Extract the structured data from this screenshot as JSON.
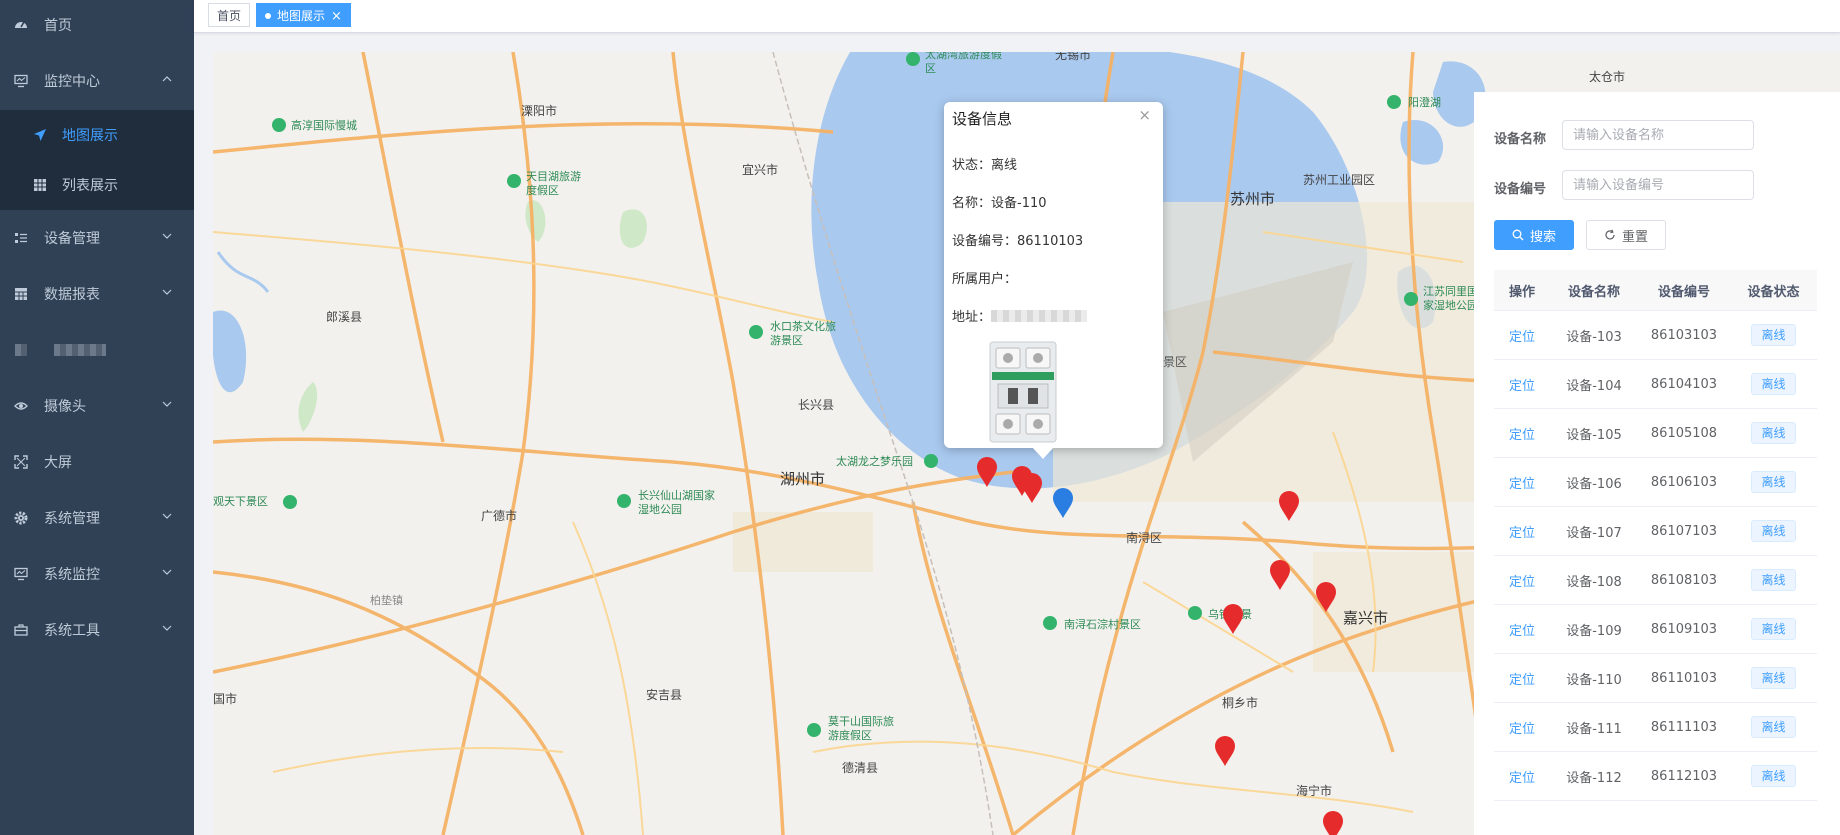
{
  "sidebar": {
    "items": [
      {
        "label": "首页",
        "icon": "dashboard-icon"
      },
      {
        "label": "监控中心",
        "icon": "monitor-icon",
        "expanded": true,
        "children": [
          {
            "label": "地图展示",
            "icon": "send-icon",
            "active": true
          },
          {
            "label": "列表展示",
            "icon": "grid-icon"
          }
        ]
      },
      {
        "label": "设备管理",
        "icon": "list-icon"
      },
      {
        "label": "数据报表",
        "icon": "table-icon"
      },
      {
        "label": "",
        "icon": "blurred-icon"
      },
      {
        "label": "摄像头",
        "icon": "eye-icon"
      },
      {
        "label": "大屏",
        "icon": "fullscreen-icon"
      },
      {
        "label": "系统管理",
        "icon": "gear-icon"
      },
      {
        "label": "系统监控",
        "icon": "monitor-icon"
      },
      {
        "label": "系统工具",
        "icon": "toolbox-icon"
      }
    ]
  },
  "tags": {
    "home": "首页",
    "current": "地图展示"
  },
  "map": {
    "labels": {
      "huzhou": "湖州市",
      "suzhou": "苏州市",
      "jiaxing": "嘉兴市",
      "changxing": "长兴县",
      "guangde": "广德市",
      "anji": "安吉县",
      "deqing": "德清县",
      "nanxun": "南浔区",
      "tongxiang": "桐乡市",
      "haining": "海宁市",
      "langxi": "郎溪县",
      "liyang": "溧阳市",
      "yixing": "宜兴市",
      "suzhou_ind": "苏州工业园区",
      "taicang": "太仓市",
      "wuxi": "无锡市",
      "baiyan": "柏垫镇",
      "ji_shi": "国市",
      "gaochun": "高淳国际慢城",
      "tianmuhu": "天目湖旅游度假区",
      "shuikou": "水口茶文化旅游景区",
      "taihulong": "太湖龙之梦乐园",
      "changxing_wetland": "长兴仙山湖国家湿地公园",
      "tianxia": "观天下景区",
      "mogan": "莫干山国际旅游度假区",
      "nanxun_scenic": "南浔石淙村景区",
      "wuzhen": "乌镇风景",
      "yangcheng": "阳澄湖",
      "jiangsu_wetland": "江苏同里国家湿地公园",
      "taihu_resort": "太湖湾旅游度假区",
      "jing_qu": "景区"
    }
  },
  "popup": {
    "title": "设备信息",
    "close": "×",
    "status_label": "状态：",
    "status": "离线",
    "name_label": "名称：",
    "name": "设备-110",
    "code_label": "设备编号：",
    "code": "86110103",
    "owner_label": "所属用户：",
    "owner": "",
    "address_label": "地址：",
    "address": ""
  },
  "search": {
    "name_label": "设备名称",
    "name_placeholder": "请输入设备名称",
    "code_label": "设备编号",
    "code_placeholder": "请输入设备编号",
    "search_btn": "搜索",
    "reset_btn": "重置"
  },
  "table": {
    "headers": [
      "操作",
      "设备名称",
      "设备编号",
      "设备状态"
    ],
    "rows": [
      {
        "action": "定位",
        "name": "设备-103",
        "code": "86103103",
        "status": "离线"
      },
      {
        "action": "定位",
        "name": "设备-104",
        "code": "86104103",
        "status": "离线"
      },
      {
        "action": "定位",
        "name": "设备-105",
        "code": "86105108",
        "status": "离线"
      },
      {
        "action": "定位",
        "name": "设备-106",
        "code": "86106103",
        "status": "离线"
      },
      {
        "action": "定位",
        "name": "设备-107",
        "code": "86107103",
        "status": "离线"
      },
      {
        "action": "定位",
        "name": "设备-108",
        "code": "86108103",
        "status": "离线"
      },
      {
        "action": "定位",
        "name": "设备-109",
        "code": "86109103",
        "status": "离线"
      },
      {
        "action": "定位",
        "name": "设备-110",
        "code": "86110103",
        "status": "离线"
      },
      {
        "action": "定位",
        "name": "设备-111",
        "code": "86111103",
        "status": "离线"
      },
      {
        "action": "定位",
        "name": "设备-112",
        "code": "86112103",
        "status": "离线"
      }
    ]
  },
  "colors": {
    "sidebar_bg": "#304156",
    "submenu_bg": "#1f2d3d",
    "accent": "#409eff",
    "pin_red": "#e52b2b",
    "pin_blue": "#2a7de1",
    "lake": "#a9c9ef"
  }
}
